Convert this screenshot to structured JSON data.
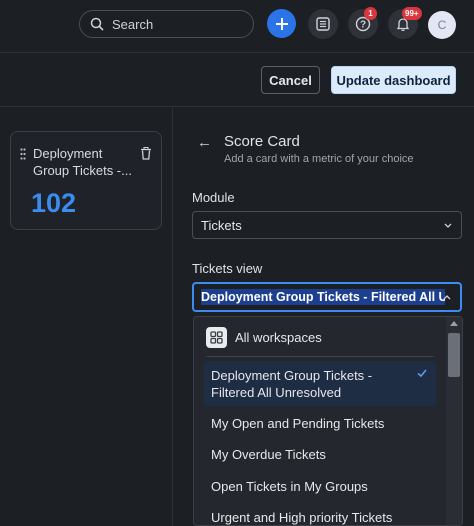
{
  "header": {
    "search_placeholder": "Search",
    "notifications_badge": "1",
    "alerts_badge": "99+",
    "avatar_initial": "C"
  },
  "actions": {
    "cancel_label": "Cancel",
    "update_label": "Update dashboard"
  },
  "preview_card": {
    "title": "Deployment Group Tickets -...",
    "value": "102"
  },
  "panel": {
    "title": "Score Card",
    "subtitle": "Add a card with a metric of your choice",
    "module_label": "Module",
    "module_value": "Tickets",
    "view_label": "Tickets view",
    "view_value": "Deployment Group Tickets - Filtered All Unresolved"
  },
  "dropdown": {
    "group_label": "All workspaces",
    "options": [
      "Deployment Group Tickets - Filtered All Unresolved",
      "My Open and Pending Tickets",
      "My Overdue Tickets",
      "Open Tickets in My Groups",
      "Urgent and High priority Tickets"
    ]
  },
  "colors": {
    "accent": "#2b74e8",
    "value_blue": "#3b8cf0",
    "badge_red": "#d9363e"
  }
}
